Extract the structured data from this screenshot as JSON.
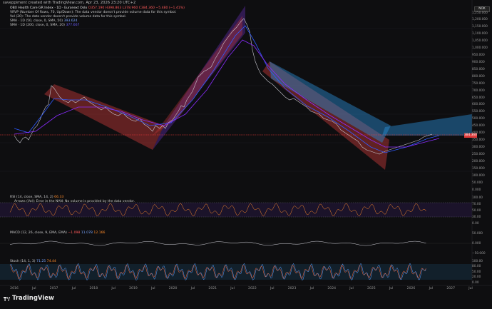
{
  "credit": "saveppiment created with TradingView.com, Apr 23, 2026 23:20 UTC+2",
  "legend": {
    "symbol": "OBX Health Care GR Index · 1D · Euronext Oslo",
    "ohlc": "O357.190 H398.863 L378.960 C384.360 −5.480 (−1.41%)",
    "vrvp": "VRVP (Number Of Rows, 70, Up/Down): The data vendor doesn't provide volume data for this symbol.",
    "vol": "Vol (20): The data vendor doesn't provide volume data for this symbol.",
    "sma1_label": "SMA · 1D (50, close, 0, SMA, 50)",
    "sma1_value": "393.624",
    "sma2_label": "SMA · 1D (200, close, 0, SMA, 20)",
    "sma2_value": "377.667"
  },
  "symbol_tag": "NOK",
  "price_tag": "384.360",
  "price_tag_code": "SMA",
  "price_axis": [
    "1,250.000",
    "1,200.000",
    "1,150.000",
    "1,100.000",
    "1,050.000",
    "1,000.000",
    "950.000",
    "900.000",
    "850.000",
    "800.000",
    "750.000",
    "700.000",
    "650.000",
    "600.000",
    "550.000",
    "500.000",
    "450.000",
    "400.000",
    "350.000",
    "300.000",
    "250.000",
    "200.000",
    "150.000",
    "100.000",
    "50.000",
    "0.000"
  ],
  "rsi": {
    "label": "RSI (14, close, SMA, 14, 2)",
    "value": "66.33",
    "note": "Arrows (Vol): Error in the NAN: No volume is provided by the data vendor.",
    "axis": [
      "100.00",
      "70.00",
      "50.00",
      "30.00",
      "0.00"
    ]
  },
  "macd": {
    "label": "MACD (12, 26, close, 9, EMA, EMA)",
    "v1": "−1.098",
    "v2": "11.078",
    "v3": "12.166",
    "axis": [
      "50.000",
      "0.000",
      "−50.000"
    ]
  },
  "stoch": {
    "label": "Stoch (14, 1, 3)",
    "v1": "71.25",
    "v2": "74.44",
    "axis": [
      "100.00",
      "80.00",
      "50.00",
      "20.00",
      "0.00"
    ]
  },
  "x_axis": [
    "2016",
    "Jul",
    "2017",
    "Jul",
    "2018",
    "Jul",
    "2019",
    "Jul",
    "2020",
    "Jul",
    "2021",
    "Jul",
    "2022",
    "Jul",
    "2023",
    "Jul",
    "2024",
    "Jul",
    "2025",
    "Jul",
    "2026",
    "Jul",
    "2027",
    "Jul"
  ],
  "brand": "TradingView",
  "colors": {
    "price_line": "#ff3b3b",
    "candle_up": "#9aa0b0",
    "sma50": "#2f5bff",
    "sma200": "#8a2cff",
    "channel_down": "#c83a3a",
    "channel_up": "#2a8fd6",
    "rsi": "#ff8c2a",
    "stoch_k": "#5aa0ff",
    "stoch_d": "#ff6a3a"
  }
}
